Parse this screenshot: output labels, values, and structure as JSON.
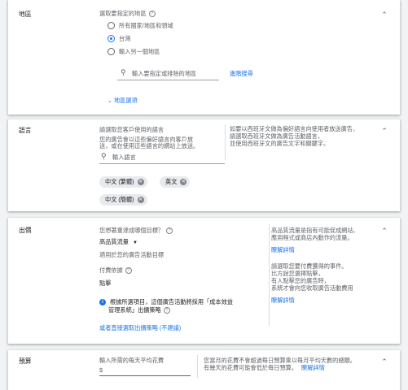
{
  "location": {
    "title": "地區",
    "heading": "選取要指定的地區",
    "options": [
      "所有國家/地區和領域",
      "台灣",
      "輸入另一個地區"
    ],
    "selected_index": 1,
    "search_placeholder": "輸入要指定或排除的地區",
    "advanced_search": "進階搜尋",
    "location_options": "地區選項"
  },
  "languages": {
    "title": "語言",
    "heading": "請選取您客戶使用的語言",
    "desc_line1": "您的廣告會以這些偏好語言向客戶放",
    "desc_line2": "送，或在使用這些語言的網站上放送。",
    "search_placeholder": "輸入語言",
    "chips": [
      "中文 (繁體)",
      "英文",
      "中文 (簡體)"
    ],
    "help_line1": "如要以西班牙文做為偏好語言向使用者放送廣告，",
    "help_line2": "請選取西班牙文做為廣告活動語言，",
    "help_line3": "並使用西班牙文的廣告文字和關鍵字。"
  },
  "bidding": {
    "title": "出價",
    "goal_question": "您想著重達成哪個目標？",
    "goal_value": "高品質流量",
    "goal_note": "適用於您的廣告活動目標",
    "payment_label": "付費依據",
    "payment_value": "點擊",
    "info_line1": "根據所選項目，這個廣告活動將採用「成本效益",
    "info_line2": "管理系統」出價策略",
    "direct_link": "或者直接選取出價策略 (不建議)",
    "help1_line1": "高品質流量是指有可能促成網站、",
    "help1_line2": "應用程式或商店內動作的流量。",
    "learn_more": "瞭解詳情",
    "help2_line1": "請選取您要付費獲得的事件。",
    "help2_line2": "比方說您選擇點擊，",
    "help2_line3": "有人點擊您的廣告時，",
    "help2_line4": "系統才會向您收取廣告活動費用"
  },
  "budget": {
    "title": "預算",
    "label": "輸入所需的每天平均花費",
    "currency": "$",
    "help_line1": "您當月的花費不會超過每日預算乘以每月平均天數的總額。",
    "help_line2": "有幾天的花費可能會低於每日預算。",
    "learn_more": "瞭解詳情"
  }
}
